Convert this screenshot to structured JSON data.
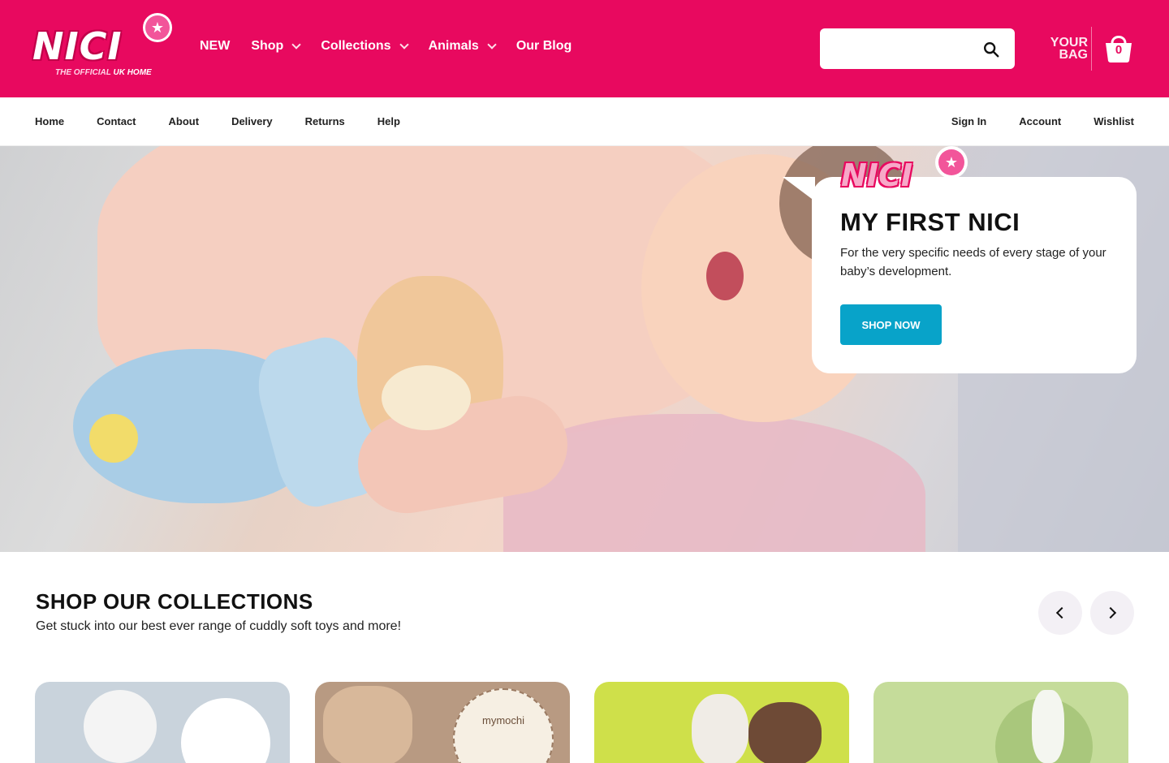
{
  "brand": {
    "logo_text": "NICI",
    "tagline_a": "THE OFFICIAL",
    "tagline_b": "UK HOME"
  },
  "main_nav": [
    {
      "label": "NEW",
      "has_dropdown": false
    },
    {
      "label": "Shop",
      "has_dropdown": true
    },
    {
      "label": "Collections",
      "has_dropdown": true
    },
    {
      "label": "Animals",
      "has_dropdown": true
    },
    {
      "label": "Our Blog",
      "has_dropdown": false
    }
  ],
  "search": {
    "placeholder": "",
    "value": ""
  },
  "bag": {
    "label_line1": "YOUR",
    "label_line2": "BAG",
    "count": "0"
  },
  "sub_nav": {
    "left": [
      "Home",
      "Contact",
      "About",
      "Delivery",
      "Returns",
      "Help"
    ],
    "right": [
      "Sign In",
      "Account",
      "Wishlist"
    ]
  },
  "hero": {
    "logo_text": "NICI",
    "title": "MY FIRST NICI",
    "text": "For the very specific needs of every stage of your baby’s development.",
    "cta": "SHOP NOW"
  },
  "collections": {
    "title": "SHOP OUR COLLECTIONS",
    "subtitle": "Get stuck into our best ever range of cuddly soft toys and more!",
    "card_3_badge": "mymochi"
  },
  "colors": {
    "brand_pink": "#e8095f",
    "cta_blue": "#08a3c9"
  }
}
